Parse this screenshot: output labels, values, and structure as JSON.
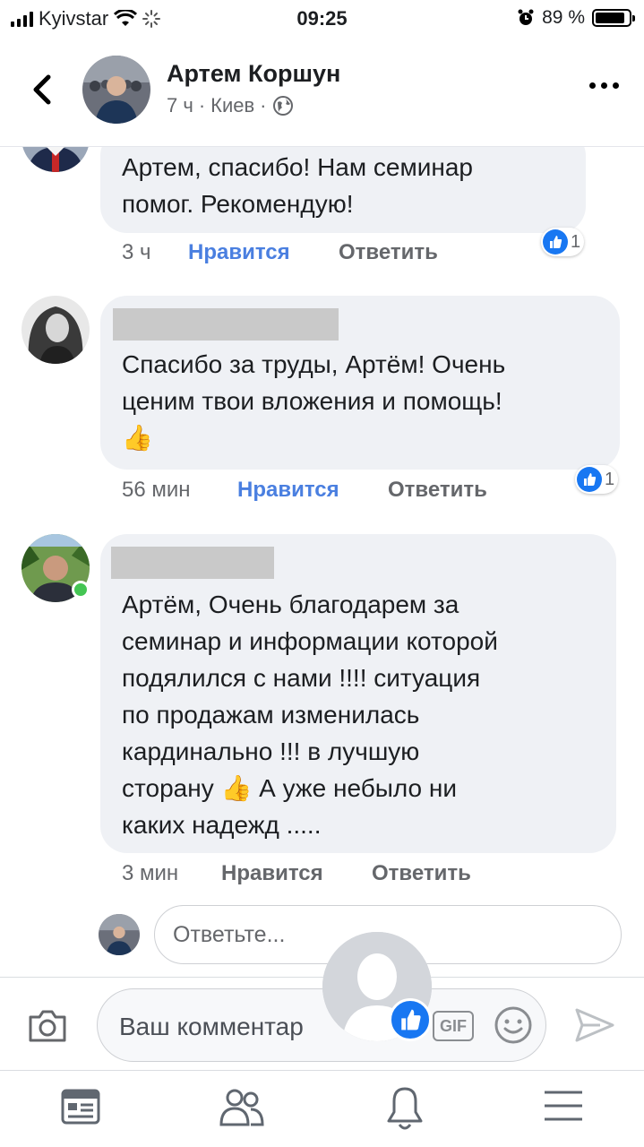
{
  "status_bar": {
    "carrier": "Kyivstar",
    "time": "09:25",
    "battery_percent": "89 %",
    "battery_level": 0.89
  },
  "header": {
    "back_icon": "chevron-left-icon",
    "name": "Артем Коршун",
    "time_ago": "7 ч",
    "separator": "·",
    "location": "Киев",
    "privacy_icon": "globe-icon",
    "more_icon": "more-dots-icon"
  },
  "comments": [
    {
      "text_lines": [
        "Артем, спасибо! Нам семинар",
        "помог. Рекомендую!"
      ],
      "time": "3 ч",
      "like_label": "Нравится",
      "reply_label": "Ответить",
      "reaction_count": "1"
    },
    {
      "text_lines": [
        "Спасибо за труды, Артём! Очень",
        "ценим твои вложения и помощь!"
      ],
      "emoji": "👍",
      "time": "56 мин",
      "like_label": "Нравится",
      "reply_label": "Ответить",
      "reaction_count": "1"
    },
    {
      "text_lines": [
        "Артём, Очень благодарем за",
        "семинар и информации которой",
        "подялился с нами !!!! ситуация",
        "по продажам изменилась",
        "кардинально !!! в лучшую"
      ],
      "line6_start": "сторану",
      "line6_emoji": "👍",
      "line6_end": "А уже небыло ни",
      "last_line": "каких надежд .....",
      "time": "3 мин",
      "like_label": "Нравится",
      "reply_label": "Ответить"
    }
  ],
  "reply": {
    "placeholder": "Ответьте..."
  },
  "composer": {
    "placeholder": "Ваш комментар",
    "gif_label": "GIF",
    "camera_icon": "camera-icon",
    "emoji_icon": "smiley-icon",
    "send_icon": "send-icon"
  },
  "tabs": [
    "news-feed-icon",
    "friends-icon",
    "notifications-bell-icon",
    "menu-icon"
  ],
  "colors": {
    "accent": "#1877f2",
    "like_link": "#4a7fe0",
    "bubble": "#eff1f5",
    "online": "#44c553"
  }
}
